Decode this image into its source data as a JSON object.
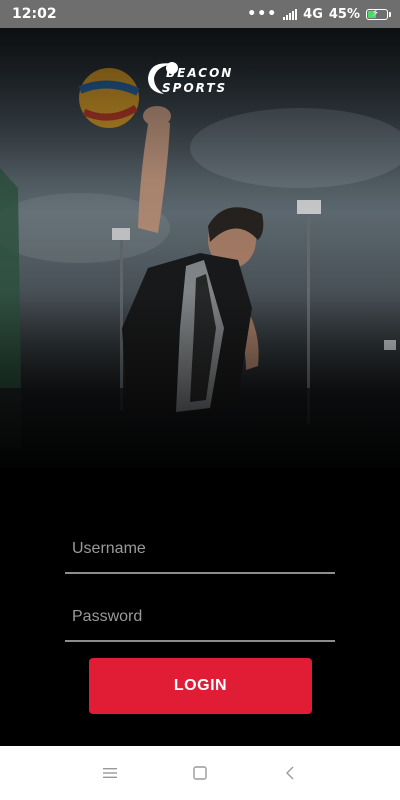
{
  "status_bar": {
    "time": "12:02",
    "dots": "•••",
    "network": "4G",
    "battery_percent": "45%",
    "battery_level": 0.45,
    "battery_color": "#4cd964"
  },
  "logo": {
    "line1": "BEACON",
    "line2": "SPORTS"
  },
  "form": {
    "username_placeholder": "Username",
    "username_value": "",
    "password_placeholder": "Password",
    "password_value": "",
    "login_label": "LOGIN"
  },
  "nav": {
    "menu_icon": "menu-icon",
    "home_icon": "square-icon",
    "back_icon": "back-chevron-icon"
  },
  "colors": {
    "accent": "#e11d36",
    "background": "#000000",
    "underline": "#8d8d8d"
  }
}
